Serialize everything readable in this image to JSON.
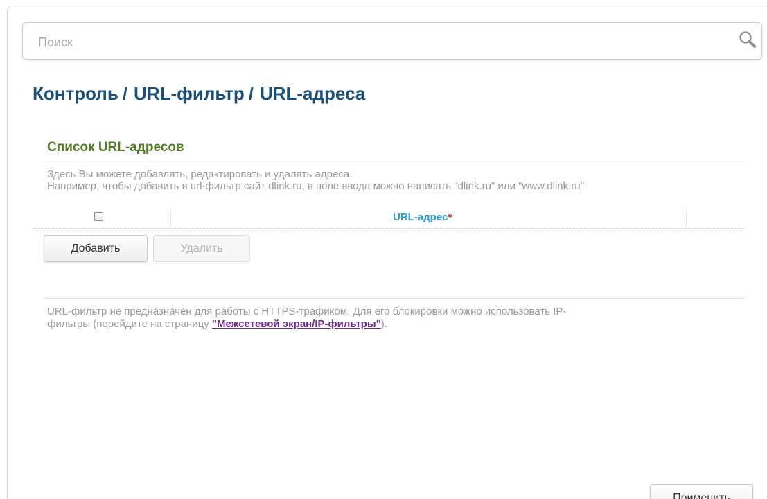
{
  "search": {
    "placeholder": "Поиск",
    "value": ""
  },
  "breadcrumb": {
    "items": [
      "Контроль",
      "URL-фильтр",
      "URL-адреса"
    ],
    "separator": "/"
  },
  "section": {
    "title": "Список URL-адресов",
    "description_line1": "Здесь Вы можете добавлять, редактировать и удалять адреса.",
    "description_line2": "Например, чтобы добавить в url-фильтр сайт dlink.ru, в поле ввода можно написать \"dlink.ru\" или \"www.dlink.ru\""
  },
  "table": {
    "select_all_checked": false,
    "column_header": "URL-адрес",
    "required_mark": "*"
  },
  "buttons": {
    "add": "Добавить",
    "delete": "Удалить",
    "apply": "Применить"
  },
  "note": {
    "line1": "URL-фильтр не предназначен для работы с HTTPS-трафиком. Для его блокировки можно использовать IP-",
    "line2_prefix": "фильтры (перейдите на страницу ",
    "link": "\"Межсетевой экран/IP-фильтры\"",
    "line2_suffix": ")."
  },
  "colors": {
    "breadcrumb": "#1a4f7a",
    "section_title": "#4f7c20",
    "column_header": "#2d9ad8",
    "required": "#e1251b",
    "link": "#6a2a8f",
    "muted_text": "#9a9a9a"
  }
}
